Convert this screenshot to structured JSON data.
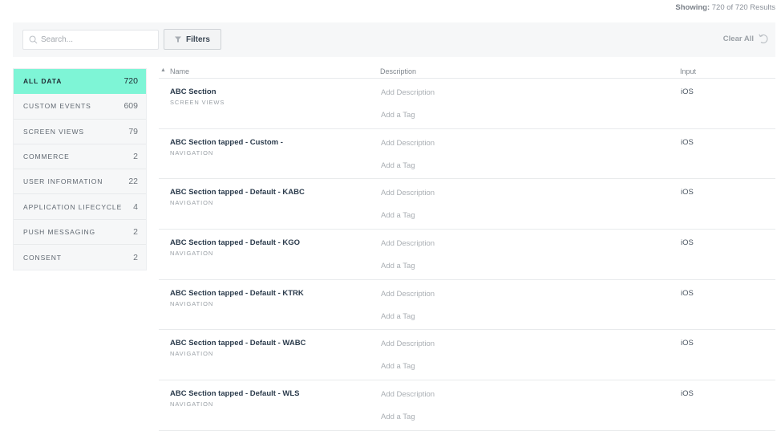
{
  "results": {
    "label": "Showing:",
    "value": "720 of 720 Results"
  },
  "toolbar": {
    "search_placeholder": "Search...",
    "search_value": "",
    "filters_label": "Filters",
    "clear_all_label": "Clear All"
  },
  "sidebar": {
    "items": [
      {
        "label": "ALL DATA",
        "count": "720",
        "active": true
      },
      {
        "label": "CUSTOM EVENTS",
        "count": "609"
      },
      {
        "label": "SCREEN VIEWS",
        "count": "79"
      },
      {
        "label": "COMMERCE",
        "count": "2"
      },
      {
        "label": "USER INFORMATION",
        "count": "22"
      },
      {
        "label": "APPLICATION LIFECYCLE",
        "count": "4"
      },
      {
        "label": "PUSH MESSAGING",
        "count": "2"
      },
      {
        "label": "CONSENT",
        "count": "2"
      }
    ]
  },
  "table": {
    "sort_indicator": "▲",
    "columns": {
      "name": "Name",
      "description": "Description",
      "input": "Input"
    },
    "rows": [
      {
        "name": "ABC Section",
        "category": "SCREEN VIEWS",
        "description": "Add Description",
        "tag": "Add a Tag",
        "input": "iOS"
      },
      {
        "name": "ABC Section tapped - Custom -",
        "category": "NAVIGATION",
        "description": "Add Description",
        "tag": "Add a Tag",
        "input": "iOS"
      },
      {
        "name": "ABC Section tapped - Default - KABC",
        "category": "NAVIGATION",
        "description": "Add Description",
        "tag": "Add a Tag",
        "input": "iOS"
      },
      {
        "name": "ABC Section tapped - Default - KGO",
        "category": "NAVIGATION",
        "description": "Add Description",
        "tag": "Add a Tag",
        "input": "iOS"
      },
      {
        "name": "ABC Section tapped - Default - KTRK",
        "category": "NAVIGATION",
        "description": "Add Description",
        "tag": "Add a Tag",
        "input": "iOS"
      },
      {
        "name": "ABC Section tapped - Default - WABC",
        "category": "NAVIGATION",
        "description": "Add Description",
        "tag": "Add a Tag",
        "input": "iOS"
      },
      {
        "name": "ABC Section tapped - Default - WLS",
        "category": "NAVIGATION",
        "description": "Add Description",
        "tag": "Add a Tag",
        "input": "iOS"
      }
    ]
  }
}
